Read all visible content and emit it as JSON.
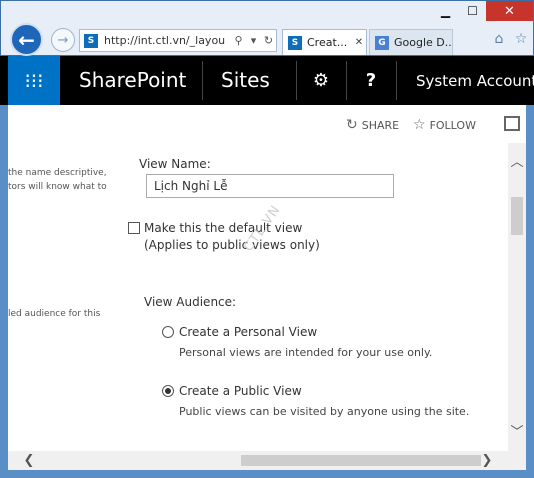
{
  "browser": {
    "window_buttons": {
      "minimize": "▁",
      "maximize": "☐",
      "close": "✕"
    },
    "back_icon": "←",
    "forward_icon": "→",
    "address": {
      "favicon": "S",
      "url": "http://int.ctl.vn/_layou"
    },
    "address_icons": {
      "search": "⚲",
      "dropdown": "▾",
      "refresh": "↻"
    },
    "tabs": [
      {
        "favicon": "S",
        "title": "Creat...",
        "close": "✕"
      },
      {
        "favicon": "G",
        "title": "Google D..."
      }
    ],
    "toolbar_icons": {
      "home": "⌂",
      "favorites": "☆"
    }
  },
  "suite_bar": {
    "launcher_icon": "⁝⁝⁝",
    "brand": "SharePoint",
    "sites": "Sites",
    "settings_icon": "⚙",
    "help_icon": "?",
    "account": "System Account"
  },
  "ribbon": {
    "share": {
      "icon": "↻",
      "label": "SHARE"
    },
    "follow": {
      "icon": "☆",
      "label": "FOLLOW"
    }
  },
  "form": {
    "name_description_line1": "the name descriptive,",
    "name_description_line2": "tors will know what to",
    "view_name_label": "View Name:",
    "view_name_value": "Lịch Nghỉ Lễ",
    "default_view_label": "Make this the default view",
    "default_view_note": "(Applies to public views only)",
    "audience_description": "led audience for this",
    "audience_label": "View Audience:",
    "personal_view": {
      "label": "Create a Personal View",
      "note": "Personal views are intended for your use only."
    },
    "public_view": {
      "label": "Create a Public View",
      "note": "Public views can be visited by anyone using the site."
    },
    "watermark": "CTL.VN"
  },
  "scrollbar_icons": {
    "up": "︿",
    "down": "﹀",
    "left": "❮",
    "right": "❯"
  }
}
